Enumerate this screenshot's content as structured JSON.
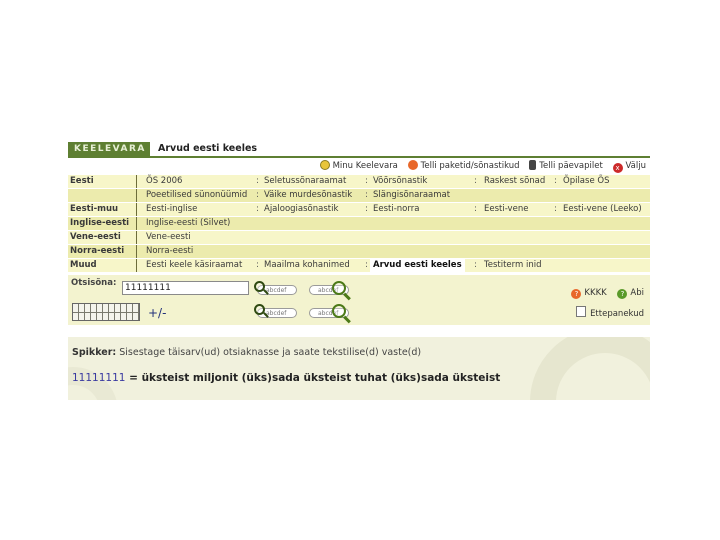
{
  "header": {
    "logo": "KEELEVARA",
    "page_title": "Arvud eesti keeles"
  },
  "top_links": [
    {
      "label": "Minu Keelevara",
      "icon": "smiley-icon"
    },
    {
      "label": "Telli paketid/sõnastikud",
      "icon": "cart-icon"
    },
    {
      "label": "Telli päevapilet",
      "icon": "phone-icon"
    },
    {
      "label": "Välju",
      "icon": "close-icon"
    }
  ],
  "dictionary_rows": [
    {
      "category": "Eesti",
      "cells": [
        "ÕS 2006",
        "Seletussõnaraamat",
        "Võõrsõnastik",
        "Raskest sõnad",
        "Õpilase ÕS"
      ]
    },
    {
      "category": "",
      "cells": [
        "Poeetilised sünonüümid",
        "Väike murdesõnastik",
        "Slängisõnaraamat"
      ]
    },
    {
      "category": "Eesti-muu",
      "cells": [
        "Eesti-inglise",
        "Ajaloogiasõnastik",
        "Eesti-norra",
        "Eesti-vene",
        "Eesti-vene (Leeko)"
      ]
    },
    {
      "category": "Inglise-eesti",
      "cells": [
        "Inglise-eesti (Silvet)"
      ]
    },
    {
      "category": "Vene-eesti",
      "cells": [
        "Vene-eesti"
      ]
    },
    {
      "category": "Norra-eesti",
      "cells": [
        "Norra-eesti"
      ]
    },
    {
      "category": "Muud",
      "cells": [
        "Eesti keele käsiraamat",
        "Maailma kohanimed",
        "Arvud eesti keeles",
        "Testiterm inid"
      ]
    }
  ],
  "search": {
    "label": "Otsisõna:",
    "value": "11111111",
    "plus_minus": "+/-",
    "btn1_text": "abcdef",
    "btn2_text": "abcdef",
    "help_label": "KKKK",
    "abi_label": "Abi",
    "ettepanekud_label": "Ettepanekud"
  },
  "output": {
    "spikker_label": "Spikker:",
    "spikker_text": "Sisestage täisarv(ud) otsiaknasse ja saate tekstilise(d) vaste(d)",
    "result_number": "11111111",
    "result_text": "= üksteist miljonit (üks)sada üksteist tuhat (üks)sada üksteist"
  },
  "colors": {
    "brand_green": "#5e7f32",
    "row_light": "#f7f6c9",
    "row_dark": "#ecebad"
  }
}
